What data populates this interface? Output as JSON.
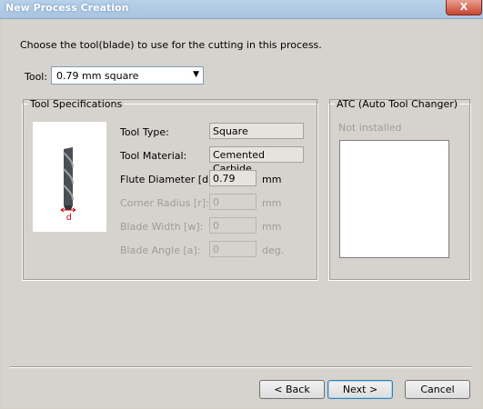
{
  "window": {
    "title": "New Process Creation",
    "close_label": "X"
  },
  "instruction": "Choose the tool(blade) to use for the cutting in this process.",
  "tool_select": {
    "label": "Tool:",
    "value": "0.79 mm square",
    "arrow": "▼"
  },
  "tool_specs": {
    "legend": "Tool Specifications",
    "rows": [
      {
        "label": "Tool Type:",
        "value": "Square",
        "unit": ""
      },
      {
        "label": "Tool Material:",
        "value": "Cemented Carbide",
        "unit": ""
      },
      {
        "label": "Flute Diameter [d]:",
        "value": "0.79",
        "unit": "mm"
      },
      {
        "label": "Corner Radius [r]:",
        "value": "0",
        "unit": "mm"
      },
      {
        "label": "Blade Width [w]:",
        "value": "0",
        "unit": "mm"
      },
      {
        "label": "Blade Angle [a]:",
        "value": "0",
        "unit": "deg."
      }
    ],
    "image_dimension_label": "d"
  },
  "atc": {
    "legend": "ATC (Auto Tool Changer)",
    "status": "Not installed"
  },
  "buttons": {
    "back": "< Back",
    "next": "Next >",
    "cancel": "Cancel"
  }
}
